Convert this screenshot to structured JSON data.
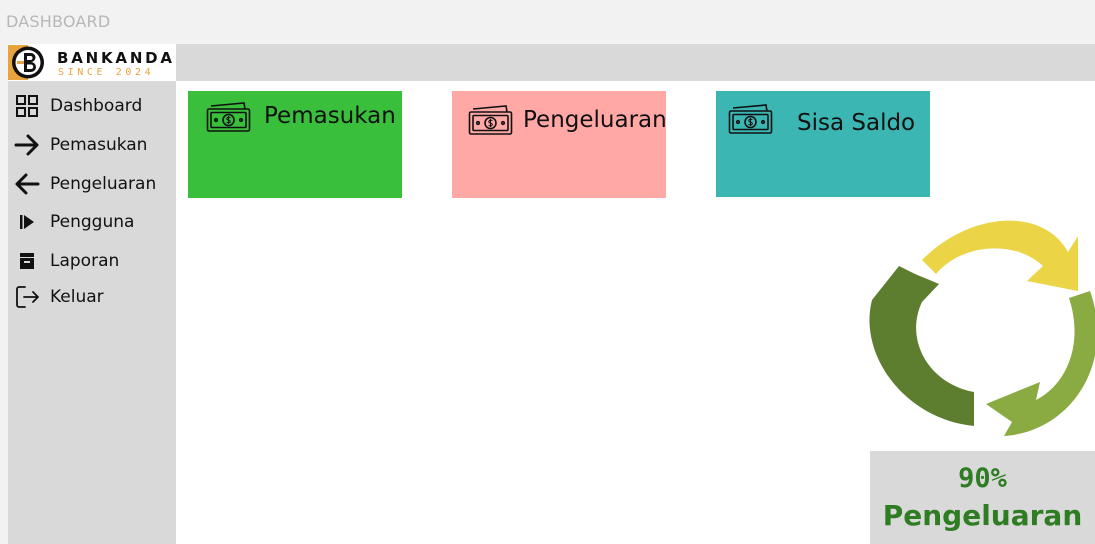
{
  "window": {
    "title": "DASHBOARD"
  },
  "brand": {
    "name": "BANKANDA",
    "tagline": "SINCE 2024",
    "logo_icon": "bank-b-logo",
    "accent_color": "#e8a33c"
  },
  "sidebar": {
    "items": [
      {
        "label": "Dashboard",
        "icon": "dashboard-grid-icon"
      },
      {
        "label": "Pemasukan",
        "icon": "arrow-right-icon"
      },
      {
        "label": "Pengeluaran",
        "icon": "arrow-left-icon"
      },
      {
        "label": "Pengguna",
        "icon": "play-bar-icon"
      },
      {
        "label": "Laporan",
        "icon": "report-icon"
      },
      {
        "label": "Keluar",
        "icon": "logout-icon"
      }
    ]
  },
  "cards": [
    {
      "label": "Pemasukan",
      "icon": "money-icon",
      "color": "#39bf3b"
    },
    {
      "label": "Pengeluaran",
      "icon": "money-icon",
      "color": "#ffa8a6"
    },
    {
      "label": "Sisa Saldo",
      "icon": "money-icon",
      "color": "#3bb6b3"
    }
  ],
  "summary": {
    "icon": "recycle-icon",
    "percent": "90%",
    "label": "Pengeluaran",
    "color": "#2f7d22"
  }
}
